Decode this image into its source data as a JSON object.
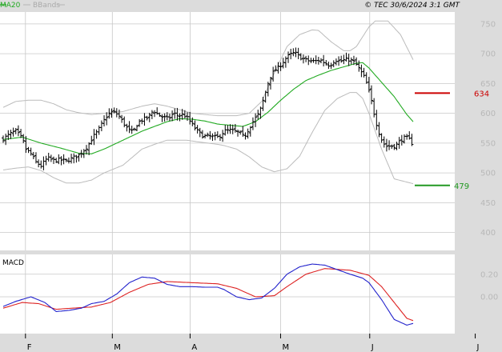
{
  "header": {
    "ma_label": "MA20",
    "bbands_label": "BBands",
    "copyright": "© TEC 30/6/2024 3:1 GMT"
  },
  "colors": {
    "ma": "#22aa22",
    "bbands": "#bbbbbb",
    "candle": "#000000",
    "macd": "#2222cc",
    "signal": "#dd2222",
    "resistance": "#cc0000",
    "support": "#229922",
    "grid": "#c8c8c8",
    "frame_bg": "#dcdcdc"
  },
  "macd_panel": {
    "title": "MACD"
  },
  "chart_data": [
    {
      "type": "candlestick",
      "title": "",
      "ylim": [
        370,
        770
      ],
      "y_ticks": [
        400,
        450,
        500,
        550,
        600,
        650,
        700,
        750
      ],
      "month_labels": [
        "F",
        "M",
        "A",
        "M",
        "J",
        "J"
      ],
      "grid": true,
      "levels": [
        {
          "name": "resistance",
          "value": 634,
          "label": "634"
        },
        {
          "name": "support",
          "value": 479,
          "label": "479"
        }
      ],
      "anchors": {
        "close": [
          [
            0,
            557
          ],
          [
            5,
            565
          ],
          [
            10,
            570
          ],
          [
            15,
            558
          ],
          [
            18,
            540
          ],
          [
            22,
            532
          ],
          [
            26,
            518
          ],
          [
            30,
            512
          ],
          [
            35,
            525
          ],
          [
            40,
            521
          ],
          [
            45,
            522
          ],
          [
            50,
            520
          ],
          [
            55,
            525
          ],
          [
            60,
            530
          ],
          [
            63,
            536
          ],
          [
            67,
            545
          ],
          [
            71,
            560
          ],
          [
            75,
            570
          ],
          [
            79,
            585
          ],
          [
            83,
            598
          ],
          [
            87,
            603
          ],
          [
            91,
            598
          ],
          [
            95,
            585
          ],
          [
            99,
            573
          ],
          [
            103,
            568
          ],
          [
            107,
            585
          ],
          [
            111,
            590
          ],
          [
            115,
            593
          ],
          [
            119,
            605
          ],
          [
            123,
            598
          ],
          [
            127,
            593
          ],
          [
            131,
            591
          ],
          [
            135,
            600
          ],
          [
            139,
            596
          ],
          [
            143,
            598
          ],
          [
            147,
            590
          ],
          [
            151,
            578
          ],
          [
            155,
            568
          ],
          [
            159,
            561
          ],
          [
            163,
            562
          ],
          [
            167,
            560
          ],
          [
            171,
            560
          ],
          [
            175,
            570
          ],
          [
            179,
            572
          ],
          [
            183,
            570
          ],
          [
            187,
            568
          ],
          [
            191,
            560
          ],
          [
            195,
            575
          ],
          [
            199,
            590
          ],
          [
            203,
            600
          ],
          [
            207,
            628
          ],
          [
            211,
            658
          ],
          [
            215,
            672
          ],
          [
            219,
            678
          ],
          [
            223,
            690
          ],
          [
            227,
            698
          ],
          [
            231,
            702
          ],
          [
            235,
            695
          ],
          [
            239,
            690
          ],
          [
            243,
            688
          ],
          [
            247,
            687
          ],
          [
            251,
            690
          ],
          [
            255,
            685
          ],
          [
            259,
            680
          ],
          [
            263,
            690
          ],
          [
            267,
            687
          ],
          [
            271,
            690
          ],
          [
            275,
            690
          ],
          [
            279,
            685
          ],
          [
            283,
            672
          ],
          [
            287,
            658
          ],
          [
            291,
            630
          ],
          [
            295,
            590
          ],
          [
            299,
            560
          ],
          [
            303,
            545
          ],
          [
            307,
            545
          ],
          [
            311,
            545
          ],
          [
            315,
            555
          ],
          [
            319,
            560
          ],
          [
            322,
            556
          ],
          [
            325,
            547
          ]
        ],
        "ma20": [
          [
            0,
            556
          ],
          [
            15,
            560
          ],
          [
            30,
            550
          ],
          [
            45,
            542
          ],
          [
            60,
            533
          ],
          [
            70,
            532
          ],
          [
            80,
            540
          ],
          [
            95,
            555
          ],
          [
            110,
            570
          ],
          [
            120,
            578
          ],
          [
            130,
            586
          ],
          [
            140,
            591
          ],
          [
            150,
            590
          ],
          [
            160,
            587
          ],
          [
            170,
            582
          ],
          [
            180,
            580
          ],
          [
            190,
            578
          ],
          [
            200,
            586
          ],
          [
            210,
            602
          ],
          [
            220,
            622
          ],
          [
            230,
            640
          ],
          [
            240,
            655
          ],
          [
            250,
            664
          ],
          [
            260,
            672
          ],
          [
            270,
            678
          ],
          [
            280,
            684
          ],
          [
            285,
            685
          ],
          [
            290,
            676
          ],
          [
            300,
            652
          ],
          [
            310,
            628
          ],
          [
            320,
            598
          ],
          [
            325,
            586
          ]
        ],
        "upper": [
          [
            0,
            610
          ],
          [
            10,
            620
          ],
          [
            20,
            622
          ],
          [
            30,
            622
          ],
          [
            40,
            616
          ],
          [
            50,
            606
          ],
          [
            60,
            601
          ],
          [
            70,
            598
          ],
          [
            80,
            600
          ],
          [
            95,
            603
          ],
          [
            110,
            612
          ],
          [
            120,
            616
          ],
          [
            130,
            612
          ],
          [
            150,
            600
          ],
          [
            170,
            596
          ],
          [
            185,
            596
          ],
          [
            195,
            600
          ],
          [
            205,
            620
          ],
          [
            215,
            668
          ],
          [
            225,
            712
          ],
          [
            235,
            732
          ],
          [
            245,
            740
          ],
          [
            250,
            739
          ],
          [
            260,
            720
          ],
          [
            270,
            705
          ],
          [
            275,
            705
          ],
          [
            280,
            712
          ],
          [
            290,
            745
          ],
          [
            295,
            755
          ],
          [
            305,
            755
          ],
          [
            315,
            732
          ],
          [
            325,
            690
          ]
        ],
        "lower": [
          [
            0,
            505
          ],
          [
            10,
            508
          ],
          [
            20,
            510
          ],
          [
            30,
            504
          ],
          [
            40,
            492
          ],
          [
            50,
            483
          ],
          [
            60,
            483
          ],
          [
            70,
            488
          ],
          [
            80,
            500
          ],
          [
            95,
            513
          ],
          [
            110,
            540
          ],
          [
            120,
            548
          ],
          [
            130,
            555
          ],
          [
            145,
            555
          ],
          [
            155,
            552
          ],
          [
            170,
            548
          ],
          [
            175,
            546
          ],
          [
            185,
            540
          ],
          [
            195,
            527
          ],
          [
            205,
            510
          ],
          [
            215,
            502
          ],
          [
            225,
            507
          ],
          [
            235,
            528
          ],
          [
            245,
            568
          ],
          [
            255,
            605
          ],
          [
            265,
            625
          ],
          [
            275,
            635
          ],
          [
            280,
            635
          ],
          [
            285,
            625
          ],
          [
            290,
            600
          ],
          [
            300,
            540
          ],
          [
            310,
            490
          ],
          [
            325,
            482
          ]
        ],
        "macd": [
          [
            0,
            -17
          ],
          [
            10,
            -8
          ],
          [
            22,
            0
          ],
          [
            33,
            -10
          ],
          [
            42,
            -26
          ],
          [
            52,
            -24
          ],
          [
            62,
            -20
          ],
          [
            70,
            -12
          ],
          [
            80,
            -8
          ],
          [
            90,
            5
          ],
          [
            100,
            25
          ],
          [
            110,
            35
          ],
          [
            120,
            33
          ],
          [
            130,
            22
          ],
          [
            140,
            18
          ],
          [
            150,
            18
          ],
          [
            160,
            17
          ],
          [
            170,
            17
          ],
          [
            175,
            13
          ],
          [
            185,
            0
          ],
          [
            195,
            -5
          ],
          [
            205,
            -2
          ],
          [
            215,
            15
          ],
          [
            225,
            40
          ],
          [
            235,
            53
          ],
          [
            245,
            58
          ],
          [
            255,
            56
          ],
          [
            265,
            48
          ],
          [
            275,
            40
          ],
          [
            285,
            33
          ],
          [
            290,
            25
          ],
          [
            300,
            -5
          ],
          [
            310,
            -40
          ],
          [
            320,
            -50
          ],
          [
            325,
            -47
          ]
        ],
        "signal": [
          [
            0,
            -20
          ],
          [
            15,
            -10
          ],
          [
            28,
            -12
          ],
          [
            42,
            -22
          ],
          [
            55,
            -20
          ],
          [
            70,
            -18
          ],
          [
            85,
            -10
          ],
          [
            100,
            8
          ],
          [
            115,
            22
          ],
          [
            130,
            27
          ],
          [
            150,
            25
          ],
          [
            170,
            23
          ],
          [
            185,
            15
          ],
          [
            200,
            0
          ],
          [
            215,
            2
          ],
          [
            225,
            18
          ],
          [
            240,
            40
          ],
          [
            255,
            50
          ],
          [
            275,
            47
          ],
          [
            290,
            38
          ],
          [
            300,
            18
          ],
          [
            310,
            -10
          ],
          [
            320,
            -38
          ],
          [
            325,
            -42
          ]
        ]
      }
    },
    {
      "type": "line",
      "title": "MACD",
      "ylim": [
        -65,
        75
      ],
      "y_ticks": [
        "0.20",
        "0.00"
      ],
      "series": [
        {
          "name": "MACD",
          "color": "#2222cc"
        },
        {
          "name": "Signal",
          "color": "#dd2222"
        }
      ],
      "grid": true
    }
  ]
}
